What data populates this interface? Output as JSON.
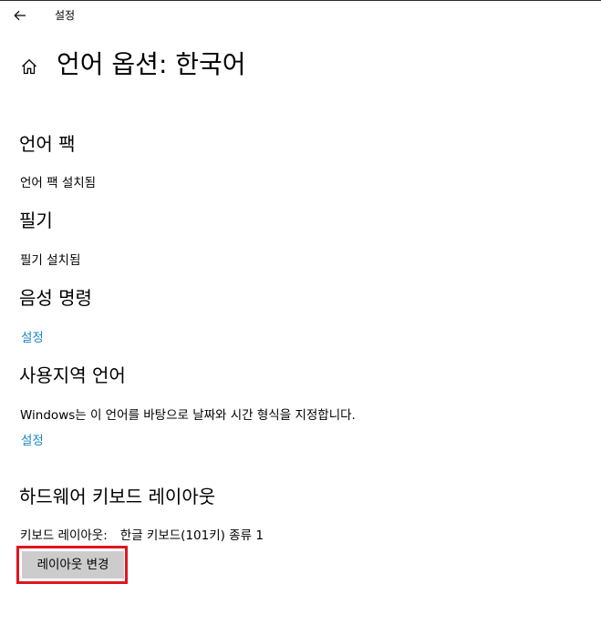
{
  "window": {
    "title": "설정"
  },
  "icons": {
    "back": "back-arrow-icon",
    "home": "home-icon"
  },
  "page": {
    "title": "언어 옵션: 한국어"
  },
  "sections": {
    "language_pack": {
      "heading": "언어 팩",
      "status": "언어 팩 설치됨"
    },
    "handwriting": {
      "heading": "필기",
      "status": "필기 설치됨"
    },
    "speech": {
      "heading": "음성 명령",
      "settings_link": "설정"
    },
    "regional": {
      "heading": "사용지역 언어",
      "description": "Windows는 이 언어를 바탕으로 날짜와 시간 형식을 지정합니다.",
      "settings_link": "설정"
    },
    "hardware_keyboard": {
      "heading": "하드웨어 키보드 레이아웃",
      "layout_label": "키보드 레이아웃:",
      "layout_value": "한글 키보드(101키) 종류 1",
      "change_button": "레이아웃 변경"
    }
  },
  "colors": {
    "link": "#1a86c6",
    "button_bg": "#cccccc",
    "highlight": "#e0141e"
  }
}
